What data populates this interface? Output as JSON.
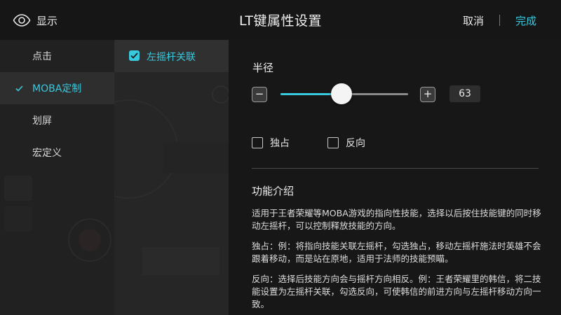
{
  "header": {
    "display_label": "显示",
    "title": "LT键属性设置",
    "cancel_label": "取消",
    "done_label": "完成"
  },
  "sidebar": {
    "items": [
      {
        "label": "点击",
        "active": false
      },
      {
        "label": "MOBA定制",
        "active": true
      },
      {
        "label": "划屏",
        "active": false
      },
      {
        "label": "宏定义",
        "active": false
      }
    ]
  },
  "middle": {
    "checkbox_label": "左摇杆关联",
    "checked": true
  },
  "panel": {
    "radius_label": "半径",
    "minus_label": "−",
    "plus_label": "+",
    "radius_value": "63",
    "slider_fraction": 0.48,
    "options": [
      {
        "label": "独占",
        "checked": false
      },
      {
        "label": "反向",
        "checked": false
      }
    ],
    "intro_title": "功能介绍",
    "intro_paragraphs": [
      "适用于王者荣耀等MOBA游戏的指向性技能，选择以后按住技能键的同时移动左摇杆，可以控制释放技能的方向。",
      "独占：例：将指向技能关联左摇杆，勾选独占，移动左摇杆施法时英雄不会跟着移动，而是站在原地，适用于法师的技能预瞄。",
      "反向：选择后技能方向会与摇杆方向相反。例：王者荣耀里的韩信，将二技能设置为左摇杆关联，勾选反向，可使韩信的前进方向与左摇杆移动方向一致。"
    ]
  },
  "colors": {
    "accent": "#38c9de",
    "background": "#171717",
    "sidebar": "#212121"
  }
}
